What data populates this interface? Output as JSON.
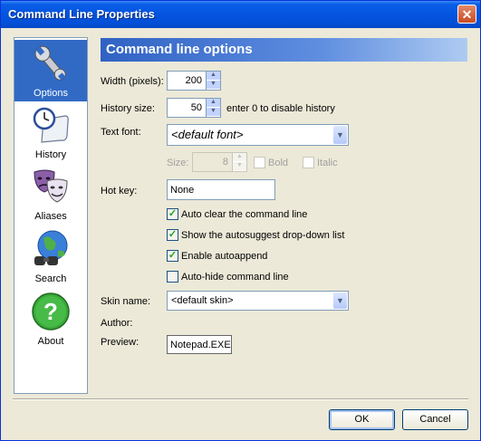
{
  "window": {
    "title": "Command Line Properties",
    "close": "✕"
  },
  "sidebar": {
    "items": [
      {
        "label": "Options",
        "icon": "wrench-icon",
        "selected": true
      },
      {
        "label": "History",
        "icon": "clock-scroll-icon"
      },
      {
        "label": "Aliases",
        "icon": "masks-icon"
      },
      {
        "label": "Search",
        "icon": "globe-binoculars-icon"
      },
      {
        "label": "About",
        "icon": "question-icon"
      }
    ]
  },
  "section": {
    "title": "Command line options"
  },
  "form": {
    "width_label": "Width (pixels):",
    "width_value": "200",
    "history_label": "History size:",
    "history_value": "50",
    "history_hint": "enter 0 to disable history",
    "font_label": "Text font:",
    "font_value": "<default font>",
    "size_label": "Size:",
    "size_value": "8",
    "bold_label": "Bold",
    "italic_label": "Italic",
    "hotkey_label": "Hot key:",
    "hotkey_value": "None",
    "skin_label": "Skin name:",
    "skin_value": "<default skin>",
    "author_label": "Author:",
    "preview_label": "Preview:",
    "preview_value": "Notepad.EXE"
  },
  "checkboxes": [
    {
      "label": "Auto clear the command line",
      "checked": true
    },
    {
      "label": "Show the autosuggest drop-down list",
      "checked": true
    },
    {
      "label": "Enable autoappend",
      "checked": true
    },
    {
      "label": "Auto-hide command line",
      "checked": false
    }
  ],
  "buttons": {
    "ok": "OK",
    "cancel": "Cancel"
  },
  "colors": {
    "titlebar": "#0454e0",
    "selection": "#316ac5",
    "dialog": "#ece9d8"
  }
}
